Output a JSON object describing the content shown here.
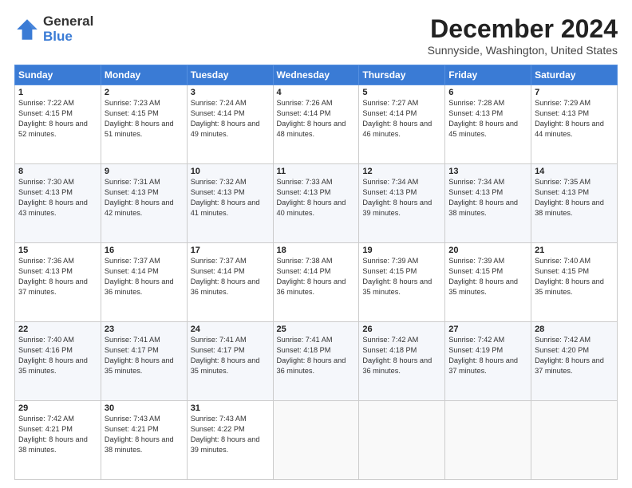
{
  "logo": {
    "general": "General",
    "blue": "Blue"
  },
  "title": "December 2024",
  "location": "Sunnyside, Washington, United States",
  "headers": [
    "Sunday",
    "Monday",
    "Tuesday",
    "Wednesday",
    "Thursday",
    "Friday",
    "Saturday"
  ],
  "weeks": [
    [
      {
        "day": "1",
        "sunrise": "7:22 AM",
        "sunset": "4:15 PM",
        "daylight": "8 hours and 52 minutes."
      },
      {
        "day": "2",
        "sunrise": "7:23 AM",
        "sunset": "4:15 PM",
        "daylight": "8 hours and 51 minutes."
      },
      {
        "day": "3",
        "sunrise": "7:24 AM",
        "sunset": "4:14 PM",
        "daylight": "8 hours and 49 minutes."
      },
      {
        "day": "4",
        "sunrise": "7:26 AM",
        "sunset": "4:14 PM",
        "daylight": "8 hours and 48 minutes."
      },
      {
        "day": "5",
        "sunrise": "7:27 AM",
        "sunset": "4:14 PM",
        "daylight": "8 hours and 46 minutes."
      },
      {
        "day": "6",
        "sunrise": "7:28 AM",
        "sunset": "4:13 PM",
        "daylight": "8 hours and 45 minutes."
      },
      {
        "day": "7",
        "sunrise": "7:29 AM",
        "sunset": "4:13 PM",
        "daylight": "8 hours and 44 minutes."
      }
    ],
    [
      {
        "day": "8",
        "sunrise": "7:30 AM",
        "sunset": "4:13 PM",
        "daylight": "8 hours and 43 minutes."
      },
      {
        "day": "9",
        "sunrise": "7:31 AM",
        "sunset": "4:13 PM",
        "daylight": "8 hours and 42 minutes."
      },
      {
        "day": "10",
        "sunrise": "7:32 AM",
        "sunset": "4:13 PM",
        "daylight": "8 hours and 41 minutes."
      },
      {
        "day": "11",
        "sunrise": "7:33 AM",
        "sunset": "4:13 PM",
        "daylight": "8 hours and 40 minutes."
      },
      {
        "day": "12",
        "sunrise": "7:34 AM",
        "sunset": "4:13 PM",
        "daylight": "8 hours and 39 minutes."
      },
      {
        "day": "13",
        "sunrise": "7:34 AM",
        "sunset": "4:13 PM",
        "daylight": "8 hours and 38 minutes."
      },
      {
        "day": "14",
        "sunrise": "7:35 AM",
        "sunset": "4:13 PM",
        "daylight": "8 hours and 38 minutes."
      }
    ],
    [
      {
        "day": "15",
        "sunrise": "7:36 AM",
        "sunset": "4:13 PM",
        "daylight": "8 hours and 37 minutes."
      },
      {
        "day": "16",
        "sunrise": "7:37 AM",
        "sunset": "4:14 PM",
        "daylight": "8 hours and 36 minutes."
      },
      {
        "day": "17",
        "sunrise": "7:37 AM",
        "sunset": "4:14 PM",
        "daylight": "8 hours and 36 minutes."
      },
      {
        "day": "18",
        "sunrise": "7:38 AM",
        "sunset": "4:14 PM",
        "daylight": "8 hours and 36 minutes."
      },
      {
        "day": "19",
        "sunrise": "7:39 AM",
        "sunset": "4:15 PM",
        "daylight": "8 hours and 35 minutes."
      },
      {
        "day": "20",
        "sunrise": "7:39 AM",
        "sunset": "4:15 PM",
        "daylight": "8 hours and 35 minutes."
      },
      {
        "day": "21",
        "sunrise": "7:40 AM",
        "sunset": "4:15 PM",
        "daylight": "8 hours and 35 minutes."
      }
    ],
    [
      {
        "day": "22",
        "sunrise": "7:40 AM",
        "sunset": "4:16 PM",
        "daylight": "8 hours and 35 minutes."
      },
      {
        "day": "23",
        "sunrise": "7:41 AM",
        "sunset": "4:17 PM",
        "daylight": "8 hours and 35 minutes."
      },
      {
        "day": "24",
        "sunrise": "7:41 AM",
        "sunset": "4:17 PM",
        "daylight": "8 hours and 35 minutes."
      },
      {
        "day": "25",
        "sunrise": "7:41 AM",
        "sunset": "4:18 PM",
        "daylight": "8 hours and 36 minutes."
      },
      {
        "day": "26",
        "sunrise": "7:42 AM",
        "sunset": "4:18 PM",
        "daylight": "8 hours and 36 minutes."
      },
      {
        "day": "27",
        "sunrise": "7:42 AM",
        "sunset": "4:19 PM",
        "daylight": "8 hours and 37 minutes."
      },
      {
        "day": "28",
        "sunrise": "7:42 AM",
        "sunset": "4:20 PM",
        "daylight": "8 hours and 37 minutes."
      }
    ],
    [
      {
        "day": "29",
        "sunrise": "7:42 AM",
        "sunset": "4:21 PM",
        "daylight": "8 hours and 38 minutes."
      },
      {
        "day": "30",
        "sunrise": "7:43 AM",
        "sunset": "4:21 PM",
        "daylight": "8 hours and 38 minutes."
      },
      {
        "day": "31",
        "sunrise": "7:43 AM",
        "sunset": "4:22 PM",
        "daylight": "8 hours and 39 minutes."
      },
      null,
      null,
      null,
      null
    ]
  ],
  "cell_labels": {
    "sunrise": "Sunrise: ",
    "sunset": "Sunset: ",
    "daylight": "Daylight: "
  }
}
